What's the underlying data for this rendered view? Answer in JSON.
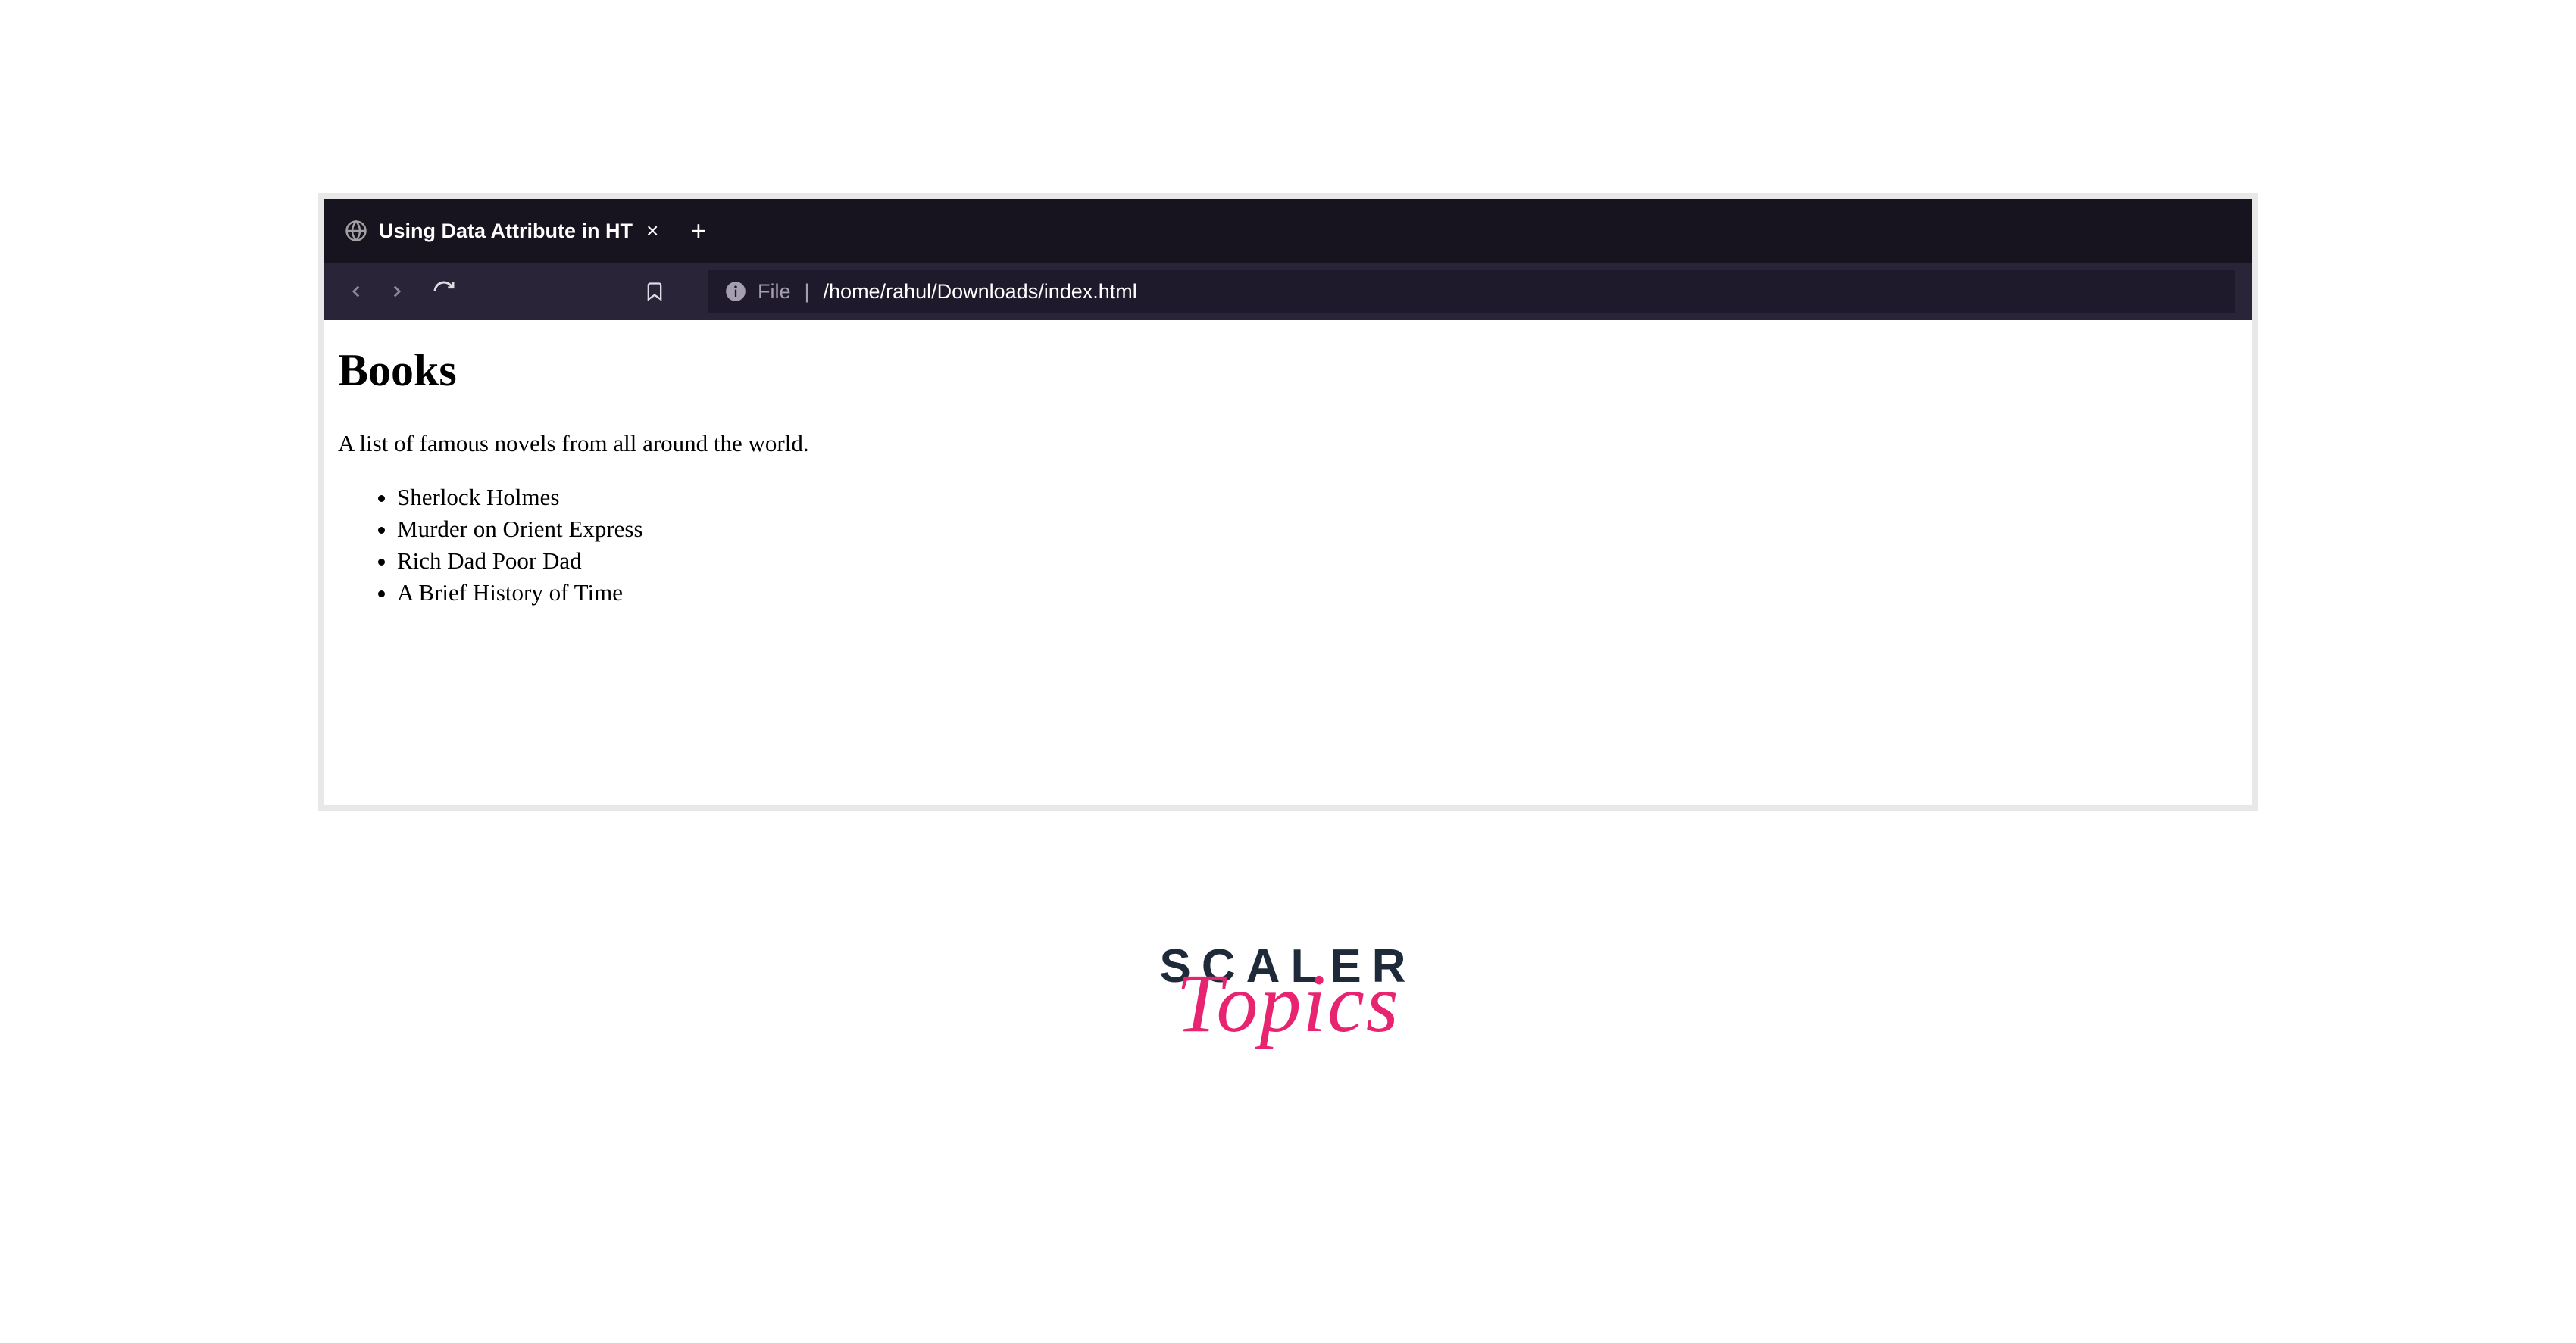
{
  "browser": {
    "tab": {
      "title": "Using Data Attribute in HT"
    },
    "url": {
      "protocol": "File",
      "path": "/home/rahul/Downloads/index.html"
    }
  },
  "page": {
    "heading": "Books",
    "description": "A list of famous novels from all around the world.",
    "books": [
      "Sherlock Holmes",
      "Murder on Orient Express",
      "Rich Dad Poor Dad",
      "A Brief History of Time"
    ]
  },
  "logo": {
    "brand": "SCALER",
    "subtitle": "Topics"
  }
}
